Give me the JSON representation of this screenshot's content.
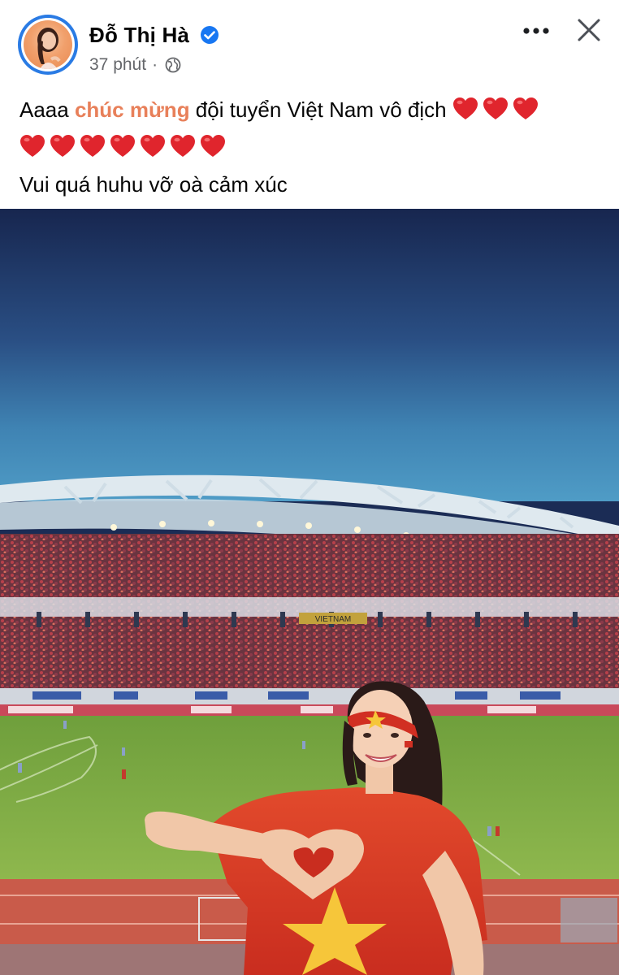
{
  "post": {
    "author": "Đỗ Thị Hà",
    "time": "37 phút",
    "separator": "·",
    "text_prefix": "Aaaa ",
    "text_highlight": "chúc mừng",
    "text_line1_rest": " đội tuyển Việt Nam vô địch",
    "text_line3": "Vui quá huhu vỡ oà cảm xúc",
    "hearts_line1": 3,
    "hearts_line2": 7
  },
  "stadium": {
    "banner_text": "VIETNAM"
  },
  "icons": {
    "verified": "verified-badge-icon",
    "audience": "globe-icon",
    "more": "more-options-icon",
    "close": "close-icon",
    "heart": "red-heart-emoji"
  },
  "colors": {
    "verified_blue": "#1877f2",
    "highlight": "#e8805a",
    "meta_gray": "#65676b",
    "heart_red": "#e0252d"
  }
}
